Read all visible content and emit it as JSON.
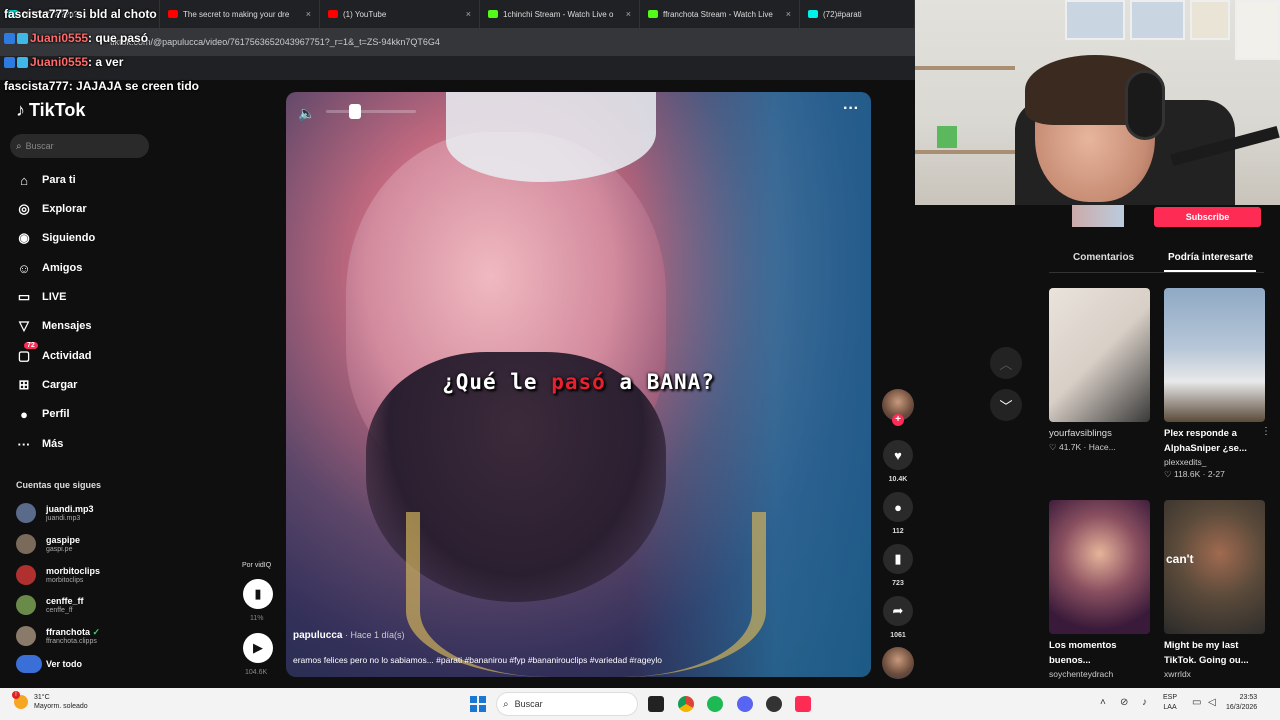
{
  "browser": {
    "tabs": [
      {
        "title": "Nt?? -??? ??u? ...",
        "fav": "#00f2ea"
      },
      {
        "title": "The secret to making your dre",
        "fav": "#ff0000"
      },
      {
        "title": "(1) YouTube",
        "fav": "#ff0000"
      },
      {
        "title": "1chinchi Stream - Watch Live o",
        "fav": "#53fc18"
      },
      {
        "title": "ffranchota Stream - Watch Live",
        "fav": "#53fc18"
      },
      {
        "title": "(72)#parati",
        "fav": "#00f2ea"
      }
    ],
    "close": "×",
    "url": "tiktok.com/@papulucca/video/7617563652043967751?_r=1&_t=ZS-94kkn7QT6G4"
  },
  "chat": [
    {
      "user": "fascista777",
      "msg": " : si bld al choto",
      "color": "#ffffff",
      "badges": false
    },
    {
      "user": "Juani0555",
      "msg": " : que pasó",
      "color": "#ff5c5c",
      "badges": true
    },
    {
      "user": "Juani0555",
      "msg": " : a ver",
      "color": "#ff5c5c",
      "badges": true
    },
    {
      "user": "fascista777",
      "msg": " : JAJAJA se creen tido",
      "color": "#ffffff",
      "badges": false
    }
  ],
  "tiktok": {
    "logo": "TikTok",
    "search_placeholder": "Buscar",
    "nav": [
      {
        "label": "Para ti",
        "icon": "home-icon"
      },
      {
        "label": "Explorar",
        "icon": "compass-icon"
      },
      {
        "label": "Siguiendo",
        "icon": "following-icon"
      },
      {
        "label": "Amigos",
        "icon": "friends-icon"
      },
      {
        "label": "LIVE",
        "icon": "live-icon"
      },
      {
        "label": "Mensajes",
        "icon": "message-icon"
      },
      {
        "label": "Actividad",
        "icon": "activity-icon",
        "badge": "72"
      },
      {
        "label": "Cargar",
        "icon": "upload-icon"
      },
      {
        "label": "Perfil",
        "icon": "profile-icon"
      },
      {
        "label": "Más",
        "icon": "more-icon"
      }
    ],
    "following_title": "Cuentas que sigues",
    "following": [
      {
        "name": "juandi.mp3",
        "handle": "juandi.mp3"
      },
      {
        "name": "gaspipe",
        "handle": "gaspi.pe"
      },
      {
        "name": "morbitoclips",
        "handle": "morbitoclips"
      },
      {
        "name": "cenffe_ff",
        "handle": "cenffe_ff"
      },
      {
        "name": "ffranchota",
        "handle": "ffranchota.clipps",
        "verified": "✓"
      }
    ],
    "see_all": "Ver todo"
  },
  "vidiq": {
    "label": "Por vidIQ",
    "percent": "11%",
    "views": "104.6K"
  },
  "video": {
    "caption_pre": "¿Qué le ",
    "caption_hl": "pasó",
    "caption_post": " a BANA?",
    "author": "papulucca",
    "time": " · Hace 1 día(s)",
    "description": "eramos felices pero no lo sabiamos... #parati #bananirou #fyp #bananirouclips #variedad #rageylo",
    "volume_fraction": 0.25
  },
  "actions": {
    "likes": "10.4K",
    "comments": "112",
    "saves": "723",
    "shares": "1061"
  },
  "right": {
    "subscribe": "Subscribe",
    "tab_comments": "Comentarios",
    "tab_suggested": "Podría interesarte",
    "cards": [
      {
        "title": "yourfavsiblings",
        "author": "",
        "stats": "♡ 41.7K · Hace...",
        "thumb_text": ""
      },
      {
        "title": "Plex responde a AlphaSniper ¿se...",
        "author": "plexxedits_",
        "stats": "♡ 118.6K · 2-27",
        "thumb_text": ""
      },
      {
        "title": "Los momentos buenos...",
        "author": "soychenteydrach",
        "stats": "",
        "thumb_text": ""
      },
      {
        "title": "Might be my last TikTok. Going ou...",
        "author": "xwrrldx",
        "stats": "",
        "thumb_text": "can't"
      }
    ]
  },
  "taskbar": {
    "temp": "31°C",
    "weather": "Mayorm. soleado",
    "search": "Buscar",
    "lang1": "ESP",
    "lang2": "LAA",
    "time": "23:53",
    "date": "16/3/2026"
  }
}
